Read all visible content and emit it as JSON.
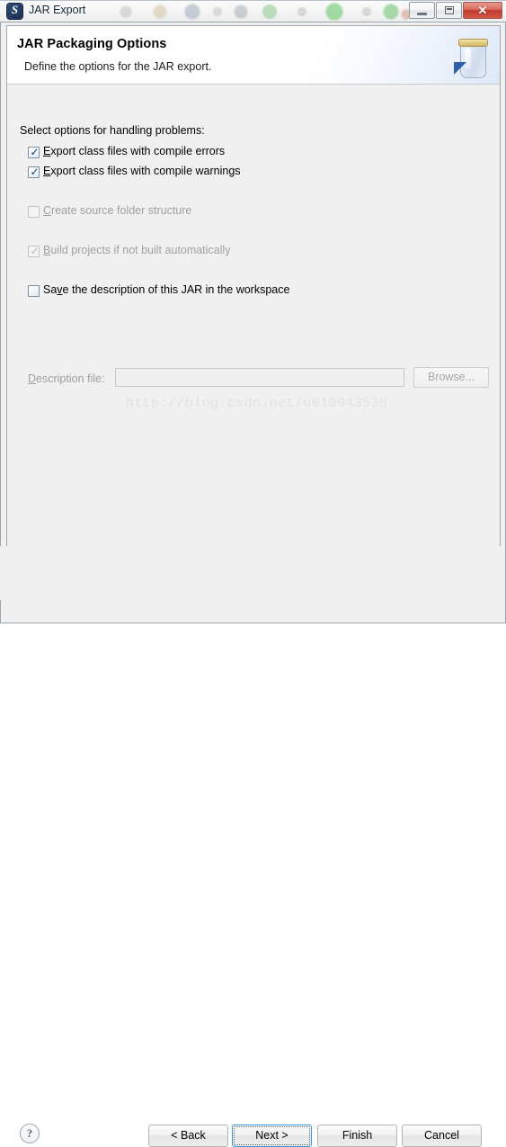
{
  "window": {
    "title": "JAR Export",
    "app_icon": "eclipse-icon",
    "controls": {
      "minimize": "minimize-button",
      "maximize": "maximize-button",
      "close": "close-button",
      "close_glyph": "✕"
    }
  },
  "header": {
    "title": "JAR Packaging Options",
    "description": "Define the options for the JAR export.",
    "icon": "jar-icon"
  },
  "content": {
    "group_label": "Select options for handling problems:",
    "options": [
      {
        "name": "export-class-files-compile-errors",
        "label_before": "E",
        "mnemonic": "",
        "label": "Export class files with compile errors",
        "checked": true,
        "enabled": true,
        "check_glyph": "✓"
      },
      {
        "name": "export-class-files-compile-warnings",
        "label": "Export class files with compile warnings",
        "checked": true,
        "enabled": true,
        "check_glyph": "✓"
      },
      {
        "name": "create-source-folder-structure",
        "label": "Create source folder structure",
        "checked": false,
        "enabled": false,
        "check_glyph": ""
      },
      {
        "name": "build-projects-if-not-built-automatically",
        "label": "Build projects if not built automatically",
        "checked": true,
        "enabled": false,
        "check_glyph": "✓"
      },
      {
        "name": "save-description-of-jar-in-workspace",
        "label": "Save the description of this JAR in the workspace",
        "checked": false,
        "enabled": true,
        "check_glyph": ""
      }
    ],
    "description_file": {
      "label": "Description file:",
      "value": "",
      "placeholder": "",
      "enabled": false,
      "browse_label": "Browse..."
    },
    "watermark": "http://blog.csdn.net/u010043538"
  },
  "footer": {
    "help_label": "?",
    "buttons": [
      {
        "name": "back-button",
        "label": "< Back",
        "default": false
      },
      {
        "name": "next-button",
        "label": "Next >",
        "default": true
      },
      {
        "name": "finish-button",
        "label": "Finish",
        "default": false
      },
      {
        "name": "cancel-button",
        "label": "Cancel",
        "default": false
      }
    ]
  },
  "colors": {
    "accent": "#3c9ad6",
    "dialog_bg": "#f0f0f0",
    "close_red": "#c2392a",
    "disabled_text": "#a0a0a0"
  }
}
